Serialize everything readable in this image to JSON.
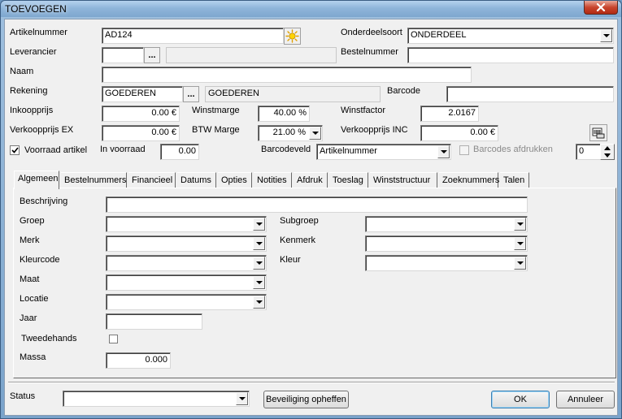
{
  "window": {
    "title": "TOEVOEGEN"
  },
  "header": {
    "artikelnummer": {
      "label": "Artikelnummer",
      "value": "AD124"
    },
    "leverancier": {
      "label": "Leverancier",
      "value": "",
      "browse": "..."
    },
    "naam": {
      "label": "Naam",
      "value": ""
    },
    "rekening": {
      "label": "Rekening",
      "value": "GOEDEREN",
      "browse": "...",
      "description": "GOEDEREN"
    },
    "inkoopprijs": {
      "label": "Inkoopprijs",
      "value": "0.00 €"
    },
    "verkoopprijs_ex": {
      "label": "Verkoopprijs EX",
      "value": "0.00 €"
    },
    "voorraad_artikel": {
      "label": "Voorraad artikel",
      "checked": true
    },
    "in_voorraad": {
      "label": "In voorraad",
      "value": "0.00"
    },
    "winstmarge": {
      "label": "Winstmarge",
      "value": "40.00 %"
    },
    "btw_marge": {
      "label": "BTW Marge",
      "value": "21.00 %"
    },
    "onderdeelsoort": {
      "label": "Onderdeelsoort",
      "value": "ONDERDEEL"
    },
    "bestelnummer": {
      "label": "Bestelnummer",
      "value": ""
    },
    "barcode": {
      "label": "Barcode",
      "value": ""
    },
    "winstfactor": {
      "label": "Winstfactor",
      "value": "2.0167"
    },
    "verkoopprijs_inc": {
      "label": "Verkoopprijs INC",
      "value": "0.00 €"
    },
    "barcodeveld": {
      "label": "Barcodeveld",
      "value": "Artikelnummer"
    },
    "barcodes_afdrukken": {
      "label": "Barcodes afdrukken",
      "checked": false,
      "count": "0"
    }
  },
  "tabs": [
    {
      "label": "Algemeen",
      "active": true
    },
    {
      "label": "Bestelnummers"
    },
    {
      "label": "Financieel"
    },
    {
      "label": "Datums"
    },
    {
      "label": "Opties"
    },
    {
      "label": "Notities"
    },
    {
      "label": "Afdruk"
    },
    {
      "label": "Toeslag"
    },
    {
      "label": "Winststructuur"
    },
    {
      "label": "Zoeknummers"
    },
    {
      "label": "Talen"
    }
  ],
  "algemeen": {
    "beschrijving": {
      "label": "Beschrijving",
      "value": ""
    },
    "groep": {
      "label": "Groep",
      "value": ""
    },
    "merk": {
      "label": "Merk",
      "value": ""
    },
    "kleurcode": {
      "label": "Kleurcode",
      "value": ""
    },
    "maat": {
      "label": "Maat",
      "value": ""
    },
    "locatie": {
      "label": "Locatie",
      "value": ""
    },
    "jaar": {
      "label": "Jaar",
      "value": ""
    },
    "tweedehands": {
      "label": "Tweedehands",
      "checked": false
    },
    "massa": {
      "label": "Massa",
      "value": "0.000"
    },
    "subgroep": {
      "label": "Subgroep",
      "value": ""
    },
    "kenmerk": {
      "label": "Kenmerk",
      "value": ""
    },
    "kleur": {
      "label": "Kleur",
      "value": ""
    }
  },
  "footer": {
    "status": {
      "label": "Status",
      "value": ""
    },
    "beveiliging_label": "Beveiliging opheffen",
    "ok_label": "OK",
    "annuleer_label": "Annuleer"
  }
}
